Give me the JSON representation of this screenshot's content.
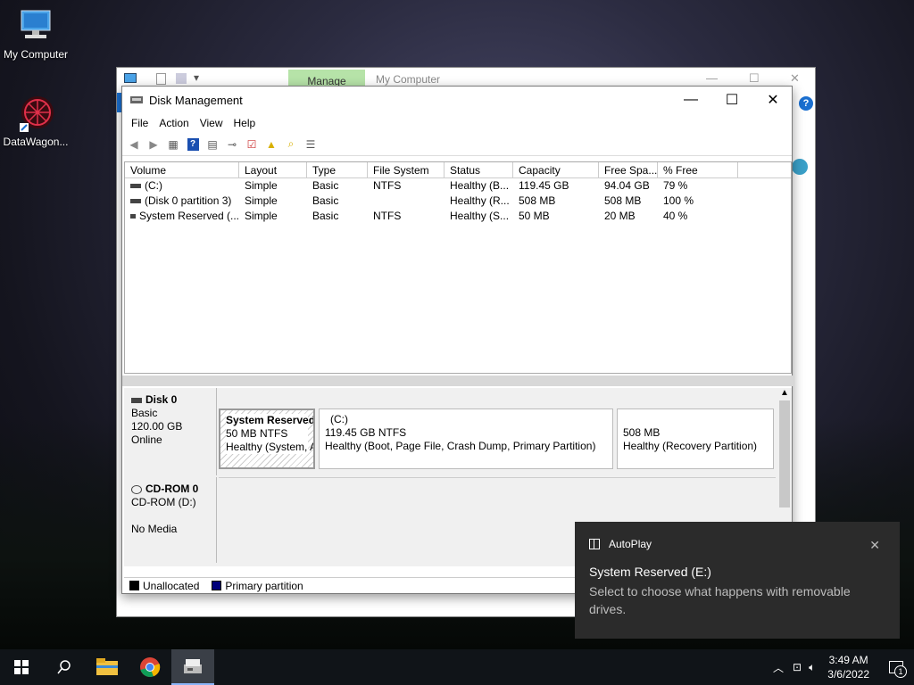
{
  "desktop": {
    "icons": [
      {
        "label": "My Computer",
        "icon": "computer-icon"
      },
      {
        "label": "DataWagon...",
        "icon": "datawagon-icon"
      }
    ]
  },
  "back_window": {
    "tab_label": "Manage",
    "title": "My Computer"
  },
  "window": {
    "title": "Disk Management",
    "menu": [
      "File",
      "Action",
      "View",
      "Help"
    ]
  },
  "volume_list": {
    "columns": [
      "Volume",
      "Layout",
      "Type",
      "File System",
      "Status",
      "Capacity",
      "Free Spa...",
      "% Free"
    ],
    "rows": [
      [
        "(C:)",
        "Simple",
        "Basic",
        "NTFS",
        "Healthy (B...",
        "119.45 GB",
        "94.04 GB",
        "79 %"
      ],
      [
        "(Disk 0 partition 3)",
        "Simple",
        "Basic",
        "",
        "Healthy (R...",
        "508 MB",
        "508 MB",
        "100 %"
      ],
      [
        "System Reserved (...",
        "Simple",
        "Basic",
        "NTFS",
        "Healthy (S...",
        "50 MB",
        "20 MB",
        "40 %"
      ]
    ]
  },
  "disk0": {
    "name": "Disk 0",
    "type": "Basic",
    "size": "120.00 GB",
    "status": "Online",
    "partitions": [
      {
        "name": "System Reserved",
        "size": "50 MB NTFS",
        "status": "Healthy (System, A"
      },
      {
        "name": "(C:)",
        "size": "119.45 GB NTFS",
        "status": "Healthy (Boot, Page File, Crash Dump, Primary Partition)"
      },
      {
        "name": "",
        "size": "508 MB",
        "status": "Healthy (Recovery Partition)"
      }
    ]
  },
  "cdrom": {
    "name": "CD-ROM 0",
    "drive": "CD-ROM (D:)",
    "media": "No Media"
  },
  "legend": {
    "unallocated": "Unallocated",
    "primary": "Primary partition",
    "unallocated_color": "#000000",
    "primary_color": "#00007a"
  },
  "toast": {
    "app": "AutoPlay",
    "heading": "System Reserved (E:)",
    "body": "Select to choose what happens with removable drives."
  },
  "taskbar": {
    "time": "3:49 AM",
    "date": "3/6/2022",
    "notification_count": "1"
  }
}
